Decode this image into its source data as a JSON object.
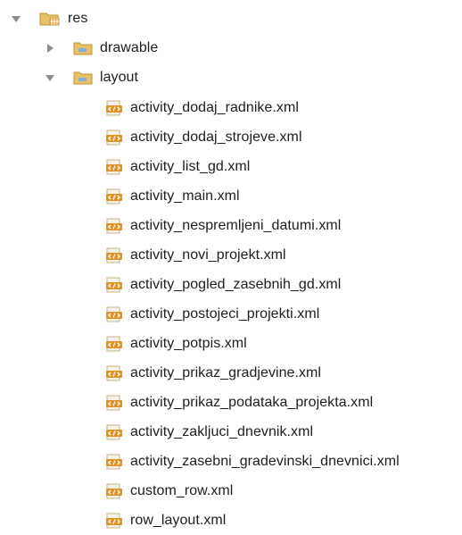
{
  "tree": {
    "root": {
      "label": "res",
      "icon": "resource-folder-icon",
      "expanded": true
    },
    "folders": [
      {
        "label": "drawable",
        "icon": "folder-icon",
        "expanded": false
      },
      {
        "label": "layout",
        "icon": "folder-icon",
        "expanded": true
      }
    ],
    "files": [
      {
        "label": "activity_dodaj_radnike.xml",
        "icon": "xml-file-icon"
      },
      {
        "label": "activity_dodaj_strojeve.xml",
        "icon": "xml-file-icon"
      },
      {
        "label": "activity_list_gd.xml",
        "icon": "xml-file-icon"
      },
      {
        "label": "activity_main.xml",
        "icon": "xml-file-icon"
      },
      {
        "label": "activity_nespremljeni_datumi.xml",
        "icon": "xml-file-icon"
      },
      {
        "label": "activity_novi_projekt.xml",
        "icon": "xml-file-icon"
      },
      {
        "label": "activity_pogled_zasebnih_gd.xml",
        "icon": "xml-file-icon"
      },
      {
        "label": "activity_postojeci_projekti.xml",
        "icon": "xml-file-icon"
      },
      {
        "label": "activity_potpis.xml",
        "icon": "xml-file-icon"
      },
      {
        "label": "activity_prikaz_gradjevine.xml",
        "icon": "xml-file-icon"
      },
      {
        "label": "activity_prikaz_podataka_projekta.xml",
        "icon": "xml-file-icon"
      },
      {
        "label": "activity_zakljuci_dnevnik.xml",
        "icon": "xml-file-icon"
      },
      {
        "label": "activity_zasebni_gradevinski_dnevnici.xml",
        "icon": "xml-file-icon"
      },
      {
        "label": "custom_row.xml",
        "icon": "xml-file-icon"
      },
      {
        "label": "row_layout.xml",
        "icon": "xml-file-icon"
      }
    ]
  },
  "colors": {
    "folder_fill": "#e8c26a",
    "folder_stroke": "#b8942c",
    "folder_inner": "#7fb0d8",
    "xml_orange": "#e0922a",
    "xml_page": "#f6f2e8",
    "arrow_gray": "#8c8c8c"
  }
}
